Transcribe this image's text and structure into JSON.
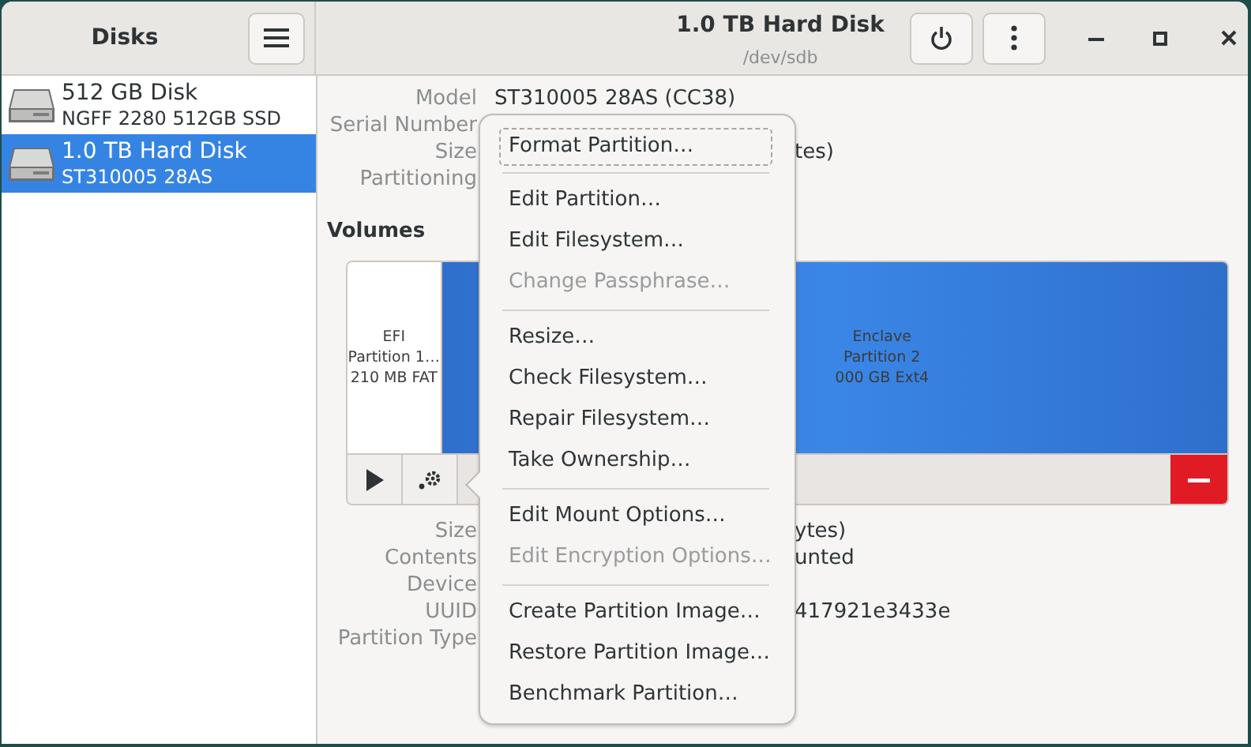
{
  "sidebar": {
    "title": "Disks",
    "disks": [
      {
        "name": "512 GB Disk",
        "model": "NGFF 2280 512GB SSD",
        "selected": false
      },
      {
        "name": "1.0 TB Hard Disk",
        "model": "ST310005 28AS",
        "selected": true
      }
    ]
  },
  "header": {
    "title": "1.0 TB Hard Disk",
    "subtitle": "/dev/sdb"
  },
  "drive_info": [
    {
      "label": "Model",
      "value": "ST310005 28AS (CC38)"
    },
    {
      "label": "Serial Number"
    },
    {
      "label": "Size",
      "value": "tes)",
      "covered": true
    },
    {
      "label": "Partitioning"
    }
  ],
  "volumes": {
    "title": "Volumes",
    "partitions": [
      {
        "lines": [
          "EFI",
          "Partition 1…",
          "210 MB FAT"
        ],
        "selected": false
      },
      {
        "lines": [
          "Enclave",
          "Partition 2",
          "000 GB Ext4"
        ],
        "selected": true
      }
    ]
  },
  "partition_info": [
    {
      "label": "Size",
      "value": "ytes)",
      "covered": true
    },
    {
      "label": "Contents",
      "value": "unted",
      "covered": true
    },
    {
      "label": "Device"
    },
    {
      "label": "UUID",
      "value": "417921e3433e",
      "covered": true
    },
    {
      "label": "Partition Type"
    }
  ],
  "menu": {
    "items": [
      {
        "kind": "item",
        "label": "Format Partition…",
        "disabled": false,
        "focused": true
      },
      {
        "kind": "separator"
      },
      {
        "kind": "item",
        "label": "Edit Partition…",
        "disabled": false,
        "focused": false
      },
      {
        "kind": "item",
        "label": "Edit Filesystem…",
        "disabled": false,
        "focused": false
      },
      {
        "kind": "item",
        "label": "Change Passphrase…",
        "disabled": true,
        "focused": false
      },
      {
        "kind": "separator"
      },
      {
        "kind": "item",
        "label": "Resize…",
        "disabled": false,
        "focused": false
      },
      {
        "kind": "item",
        "label": "Check Filesystem…",
        "disabled": false,
        "focused": false
      },
      {
        "kind": "item",
        "label": "Repair Filesystem…",
        "disabled": false,
        "focused": false
      },
      {
        "kind": "item",
        "label": "Take Ownership…",
        "disabled": false,
        "focused": false
      },
      {
        "kind": "separator"
      },
      {
        "kind": "item",
        "label": "Edit Mount Options…",
        "disabled": false,
        "focused": false
      },
      {
        "kind": "item",
        "label": "Edit Encryption Options…",
        "disabled": true,
        "focused": false
      },
      {
        "kind": "separator"
      },
      {
        "kind": "item",
        "label": "Create Partition Image…",
        "disabled": false,
        "focused": false
      },
      {
        "kind": "item",
        "label": "Restore Partition Image…",
        "disabled": false,
        "focused": false
      },
      {
        "kind": "item",
        "label": "Benchmark Partition…",
        "disabled": false,
        "focused": false
      }
    ]
  }
}
